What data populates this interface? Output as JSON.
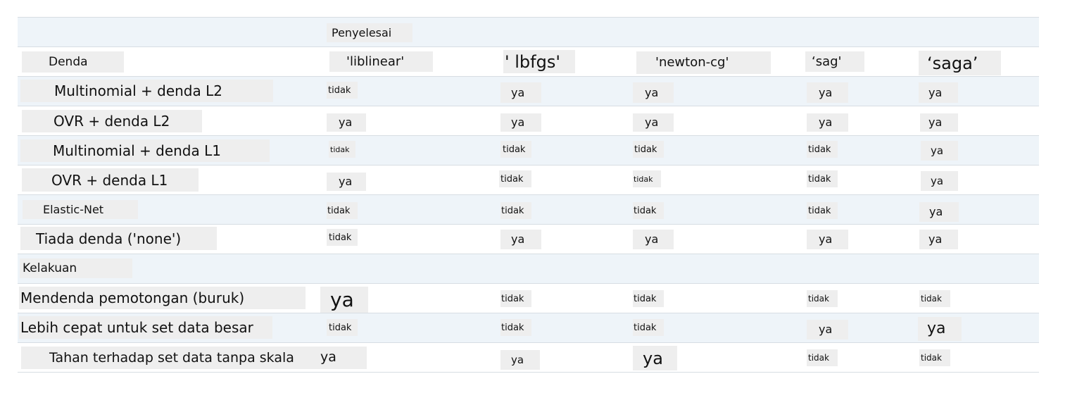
{
  "table": {
    "header": {
      "solver_label": "Penyelesai"
    },
    "penalty_header": {
      "label": "Denda",
      "solvers": [
        "'liblinear'",
        "' lbfgs'",
        "'newton-cg'",
        "‘sag'",
        "‘saga’"
      ]
    },
    "penalty_rows": [
      {
        "label": "Multinomial + denda L2",
        "values": [
          "tidak",
          "ya",
          "ya",
          "ya",
          "ya"
        ]
      },
      {
        "label": "OVR + denda L2",
        "values": [
          "ya",
          "ya",
          "ya",
          "ya",
          "ya"
        ]
      },
      {
        "label": "Multinomial + denda L1",
        "values": [
          "tidak",
          "tidak",
          "tidak",
          "tidak",
          "ya"
        ]
      },
      {
        "label": "OVR + denda L1",
        "values": [
          "ya",
          "tidak",
          "tidak",
          "tidak",
          "ya"
        ]
      },
      {
        "label": "Elastic-Net",
        "values": [
          "tidak",
          "tidak",
          "tidak",
          "tidak",
          "ya"
        ]
      },
      {
        "label": "Tiada denda ('none')",
        "values": [
          "tidak",
          "ya",
          "ya",
          "ya",
          "ya"
        ]
      }
    ],
    "behavior_section": {
      "label": "Kelakuan"
    },
    "behavior_rows": [
      {
        "label": "Mendenda pemotongan (buruk)",
        "values": [
          "ya",
          "tidak",
          "tidak",
          "tidak",
          "tidak"
        ]
      },
      {
        "label": "Lebih cepat untuk set data besar",
        "values": [
          "tidak",
          "tidak",
          "tidak",
          "ya",
          "ya"
        ]
      },
      {
        "label": "Tahan terhadap set data tanpa skala",
        "values": [
          "ya",
          "ya",
          "ya",
          "tidak",
          "tidak"
        ]
      }
    ]
  }
}
